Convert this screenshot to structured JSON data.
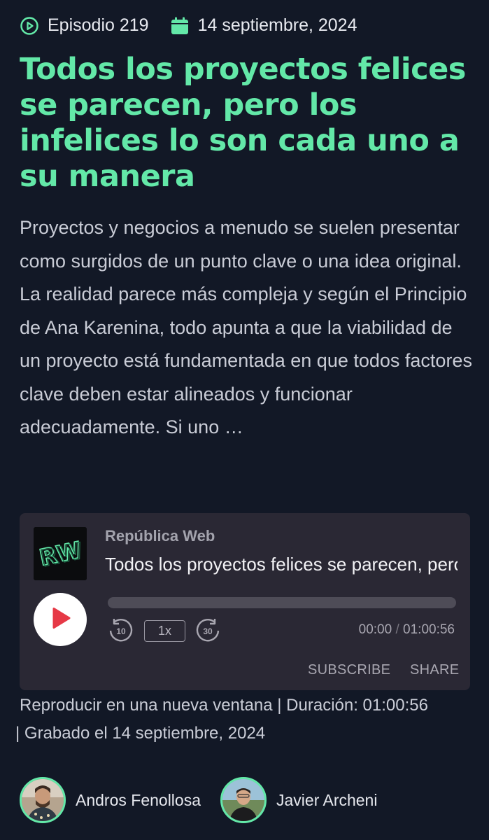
{
  "meta": {
    "episode": "Episodio 219",
    "date": "14 septiembre, 2024",
    "episode_icon": "play-circle-icon",
    "date_icon": "calendar-icon"
  },
  "title": "Todos los proyectos felices se parecen, pero los infelices lo son cada uno a su manera",
  "summary": "Proyectos y negocios a menudo se suelen presentar como surgidos de un punto clave o una idea original. La realidad parece más compleja y según el Principio de Ana Karenina, todo apunta a que la viabilidad de un proyecto está fundamentada en que todos factores clave deben estar alineados y funcionar adecuadamente. Si uno …",
  "player": {
    "show_name": "República Web",
    "episode_title": "Todos los proyectos felices se parecen, pero los infelices lo son cada uno a su manera",
    "artwork_text": "RW",
    "progress": 0,
    "skip_back": "10",
    "skip_forward": "30",
    "speed": "1x",
    "current_time": "00:00",
    "time_separator": "/",
    "duration": "01:00:56",
    "subscribe_label": "SUBSCRIBE",
    "share_label": "SHARE"
  },
  "info": {
    "new_window_link": "Reproducir en una nueva ventana",
    "sep1": " | ",
    "duration_text": "Duración: 01:00:56",
    "sep2": " | ",
    "recorded_text": "Grabado el 14 septiembre, 2024"
  },
  "authors": [
    {
      "name": "Andros Fenollosa"
    },
    {
      "name": "Javier Archeni"
    }
  ],
  "colors": {
    "background": "#121826",
    "accent": "#63e8a8",
    "player_bg": "#2a2834",
    "play_icon": "#e63946"
  }
}
